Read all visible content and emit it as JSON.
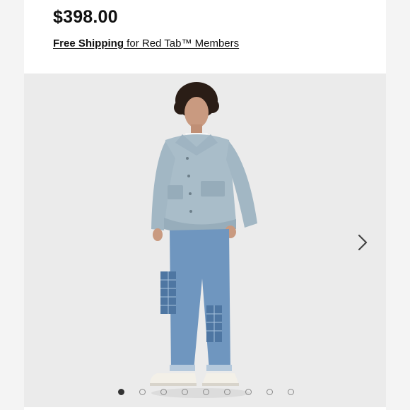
{
  "product": {
    "price": "$398.00",
    "shipping_bold": "Free Shipping",
    "shipping_rest": " for Red Tab™ Members"
  },
  "gallery": {
    "image_description_icon": "product-photo",
    "next_icon": "chevron-right-icon",
    "dot_count": 9,
    "active_dot": 0
  },
  "colors": {
    "background": "#f4f4f4",
    "card": "#ffffff",
    "image_bg": "#ebebeb",
    "text": "#111111"
  }
}
